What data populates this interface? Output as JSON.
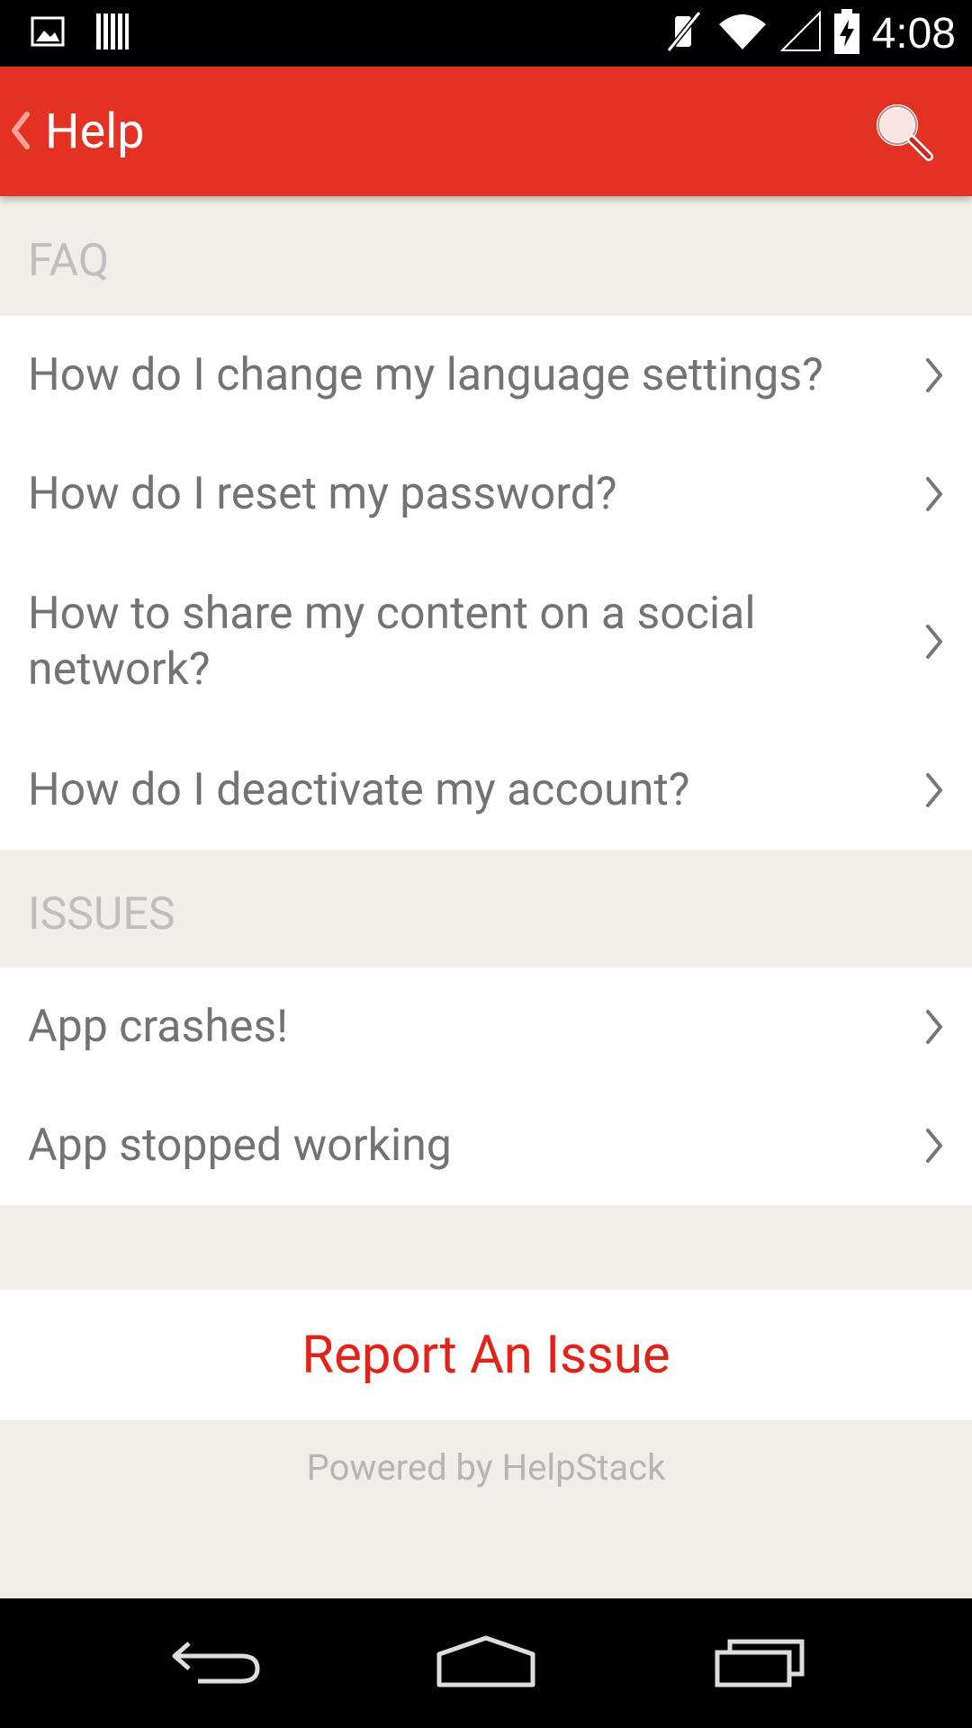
{
  "status_bar": {
    "time": "4:08",
    "left_icons": [
      "image-icon",
      "barcode-icon"
    ],
    "right_icons": [
      "vibrate-off-icon",
      "wifi-icon",
      "signal-icon",
      "battery-charging-icon"
    ]
  },
  "action_bar": {
    "title": "Help",
    "back_icon": "chevron-left-icon",
    "search_icon": "search-icon",
    "color": "#e33224"
  },
  "faq": {
    "header": "FAQ",
    "items": [
      {
        "label": "How do I change my language settings?"
      },
      {
        "label": "How do I reset my password?"
      },
      {
        "label": "How to share my content on a social network?"
      },
      {
        "label": "How do I deactivate my account?"
      }
    ]
  },
  "issues": {
    "header": "ISSUES",
    "items": [
      {
        "label": "App crashes!"
      },
      {
        "label": "App stopped working"
      }
    ]
  },
  "report_button": {
    "label": "Report An Issue",
    "color": "#e2231a"
  },
  "footer": {
    "powered_by": "Powered by HelpStack"
  },
  "nav_bar": {
    "buttons": [
      "back-icon",
      "home-icon",
      "recents-icon"
    ]
  }
}
